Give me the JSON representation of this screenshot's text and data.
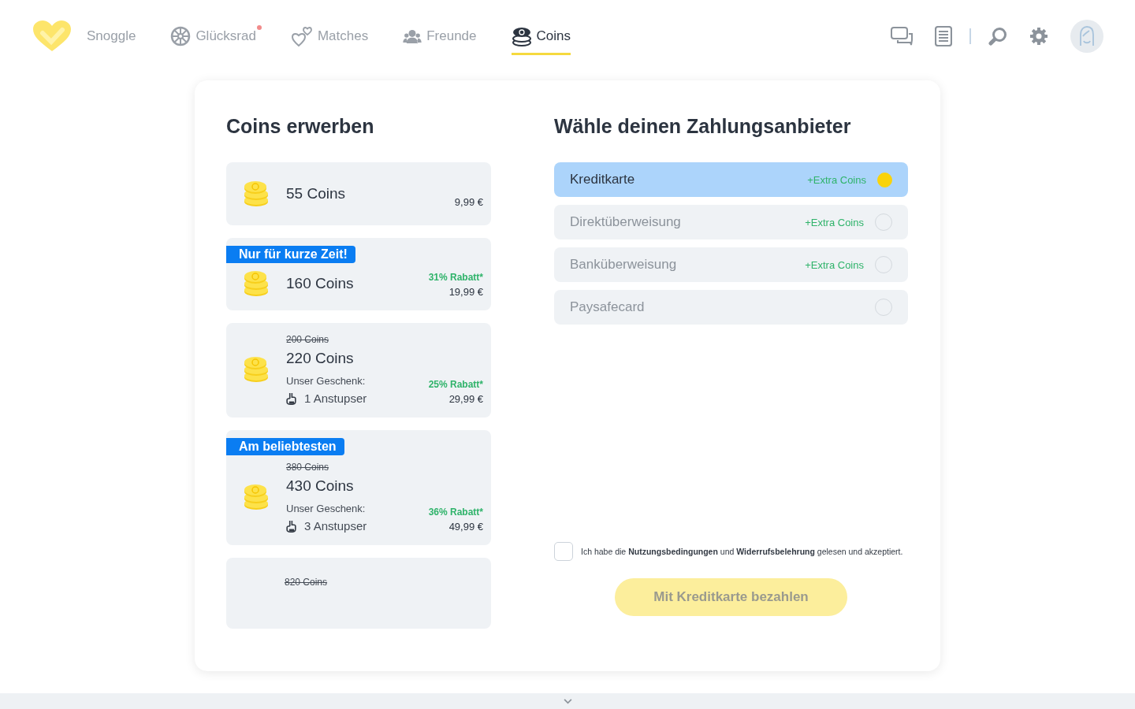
{
  "nav": {
    "tabs": [
      {
        "kind": "logo",
        "label": "Snoggle",
        "selected": false,
        "dot": false
      },
      {
        "kind": "wheel",
        "label": "Glücksrad",
        "selected": false,
        "dot": true
      },
      {
        "kind": "hearts",
        "label": "Matches",
        "selected": false,
        "dot": false
      },
      {
        "kind": "people",
        "label": "Freunde",
        "selected": false,
        "dot": false
      },
      {
        "kind": "coins",
        "label": "Coins",
        "selected": true,
        "dot": false
      }
    ]
  },
  "packages": {
    "title": "Coins erwerben",
    "items": [
      {
        "coins": "55 Coins",
        "price": "9,99 €"
      },
      {
        "badge": "Nur für kurze Zeit!",
        "coins": "160 Coins",
        "discount": "31% Rabatt*",
        "price": "19,99 €"
      },
      {
        "old": "200 Coins",
        "coins": "220 Coins",
        "gift_label": "Unser Geschenk:",
        "gift": "1 Anstupser",
        "discount": "25% Rabatt*",
        "price": "29,99 €"
      },
      {
        "badge": "Am beliebtesten",
        "old": "380 Coins",
        "coins": "430 Coins",
        "gift_label": "Unser Geschenk:",
        "gift": "3 Anstupser",
        "discount": "36% Rabatt*",
        "price": "49,99 €"
      },
      {
        "old": "820 Coins"
      }
    ]
  },
  "payment": {
    "title": "Wähle deinen Zahlungsanbieter",
    "providers": [
      {
        "name": "Kreditkarte",
        "extra": "+Extra Coins",
        "selected": true
      },
      {
        "name": "Direktüberweisung",
        "extra": "+Extra Coins",
        "selected": false
      },
      {
        "name": "Banküberweisung",
        "extra": "+Extra Coins",
        "selected": false
      },
      {
        "name": "Paysafecard",
        "selected": false
      }
    ],
    "terms": {
      "text": "Ich habe die **Nutzungsbedingungen** und **Widerrufsbelehrung** gelesen und akzeptiert.",
      "checked": false
    },
    "pay_button": {
      "label": "Mit Kreditkarte bezahlen",
      "disabled": true
    }
  }
}
